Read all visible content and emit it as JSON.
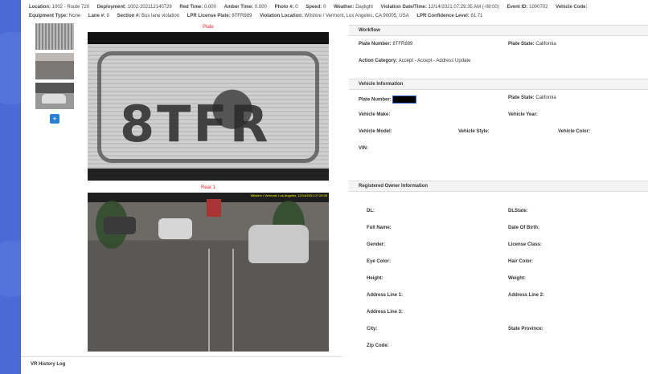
{
  "info": {
    "location_label": "Location:",
    "location": "1002 - Route 720",
    "deployment_label": "Deployment:",
    "deployment": "1002-202112140729",
    "red_time_label": "Red Time:",
    "red_time": "0.000",
    "amber_time_label": "Amber Time:",
    "amber_time": "0.000",
    "photo_label": "Photo #:",
    "photo": "0",
    "speed_label": "Speed:",
    "speed": "0",
    "weather_label": "Weather:",
    "weather": "Daylight",
    "violation_dt_label": "Violation Date/Time:",
    "violation_dt": "12/14/2021 07:29:35 AM (-08:00)",
    "event_id_label": "Event ID:",
    "event_id": "1000702",
    "vehicle_code_label": "Vehicle Code:",
    "equipment_label": "Equipment Type:",
    "equipment": "None",
    "lane_label": "Lane #:",
    "lane": "0",
    "section_label": "Section #:",
    "section": "Bus lane violation",
    "lpr_plate_label": "LPR License Plate:",
    "lpr_plate": "8TFR889",
    "violation_loc_label": "Violation Location:",
    "violation_loc": "Wilshire / Vermont, Los Angeles, CA 90005, USA",
    "lpr_conf_label": "LPR Confidence Level:",
    "lpr_conf": "81.71"
  },
  "images": {
    "plate_label": "Plate",
    "plate_text": "8TFR",
    "rear_label": "Rear 1",
    "rear_overlay": "Wilshire / Vermont, Los Angeles, 12/14/2021 07:29:35"
  },
  "history": {
    "title": "VR History Log"
  },
  "workflow": {
    "title": "Workflow",
    "plate_number_label": "Plate Number:",
    "plate_number": "8TFR889",
    "plate_state_label": "Plate State:",
    "plate_state": "California",
    "action_label": "Action Category:",
    "action": "Accept - Accept - Address Update"
  },
  "vehicle": {
    "title": "Vehicle Information",
    "plate_number_label": "Plate Number:",
    "plate_state_label": "Plate State:",
    "plate_state": "California",
    "make_label": "Vehicle Make:",
    "year_label": "Vehicle Year:",
    "model_label": "Vehicle Model:",
    "style_label": "Vehicle Style:",
    "color_label": "Vehicle Color:",
    "vin_label": "VIN:"
  },
  "owner": {
    "title": "Registered Owner Information",
    "dl_label": "DL:",
    "dlstate_label": "DLState:",
    "full_name_label": "Full Name:",
    "dob_label": "Date Of Birth:",
    "gender_label": "Gender:",
    "license_class_label": "License Class:",
    "eye_label": "Eye Color:",
    "hair_label": "Hair Color:",
    "height_label": "Height:",
    "weight_label": "Weight:",
    "addr1_label": "Address Line 1:",
    "addr2_label": "Address Line 2:",
    "addr3_label": "Address Line 3:",
    "city_label": "City:",
    "state_province_label": "State Province:",
    "zip_label": "Zip Code:"
  },
  "icons": {
    "add": "plus-icon"
  },
  "colors": {
    "background": "#4a6bd6",
    "accent": "#2a7fd1",
    "image_label": "#e23"
  }
}
